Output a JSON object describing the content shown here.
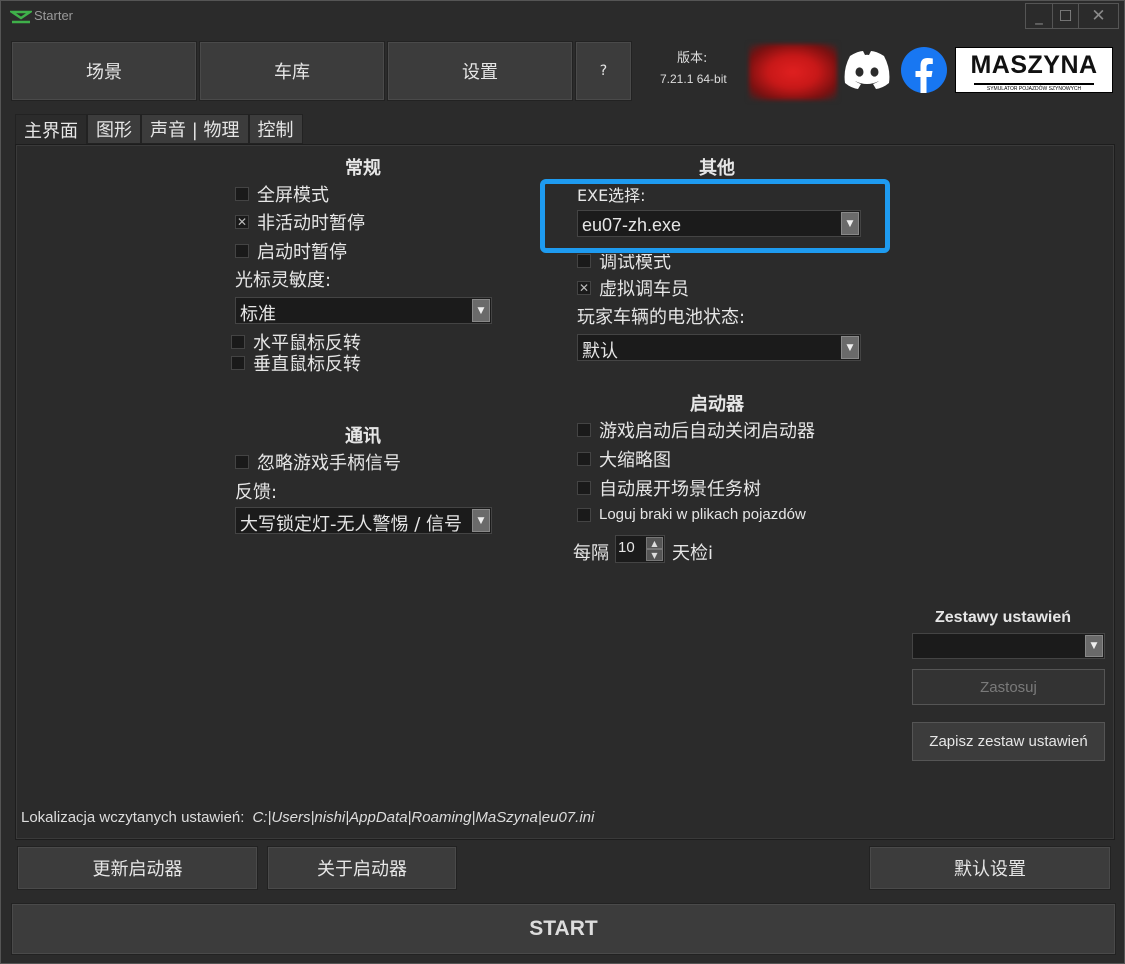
{
  "window": {
    "title": "Starter",
    "controls": {
      "minimize": "_",
      "maximize": "☐",
      "close": "✕"
    }
  },
  "top_nav": {
    "scenes": "场景",
    "depot": "车库",
    "settings": "设置",
    "help": "?"
  },
  "version": {
    "label": "版本:",
    "value": "7.21.1 64-bit"
  },
  "brand": {
    "maszyna": "MASZYNA",
    "maszyna_sub": "SYMULATOR POJAZDÓW SZYNOWYCH"
  },
  "tabs": [
    "主界面",
    "图形",
    "声音 | 物理",
    "控制"
  ],
  "general": {
    "heading": "常规",
    "fullscreen": "全屏模式",
    "pause_inactive": "非活动时暂停",
    "pause_start": "启动时暂停",
    "mouse_sens_label": "光标灵敏度:",
    "mouse_sens_value": "标准",
    "invert_h": "水平鼠标反转",
    "invert_v": "垂直鼠标反转"
  },
  "comm": {
    "heading": "通讯",
    "ignore_gamepad": "忽略游戏手柄信号",
    "feedback_label": "反馈:",
    "feedback_value": "大写锁定灯-无人警惕 / 信号"
  },
  "other": {
    "heading": "其他",
    "exe_label": "EXE选择:",
    "exe_value": "eu07-zh.exe",
    "debug_mode": "调试模式",
    "virtual_dispatcher": "虚拟调车员",
    "battery_label": "玩家车辆的电池状态:",
    "battery_value": "默认"
  },
  "launcher": {
    "heading": "启动器",
    "auto_close": "游戏启动后自动关闭启动器",
    "large_thumbs": "大缩略图",
    "expand_tree": "自动展开场景任务树",
    "log_missing": "Loguj braki w plikach pojazdów",
    "check_prefix": "每隔",
    "check_days": "10",
    "check_suffix": "天检i"
  },
  "presets": {
    "heading": "Zestawy ustawień",
    "apply": "Zastosuj",
    "save": "Zapisz zestaw ustawień"
  },
  "location": {
    "label": "Lokalizacja wczytanych ustawień:",
    "path": "C:|Users|nishi|AppData|Roaming|MaSzyna|eu07.ini"
  },
  "bottom": {
    "update": "更新启动器",
    "about": "关于启动器",
    "defaults": "默认设置",
    "start": "START"
  },
  "colors": {
    "accent_highlight": "#1e9bf0",
    "facebook": "#1877f2",
    "background": "#2b2b2b"
  }
}
